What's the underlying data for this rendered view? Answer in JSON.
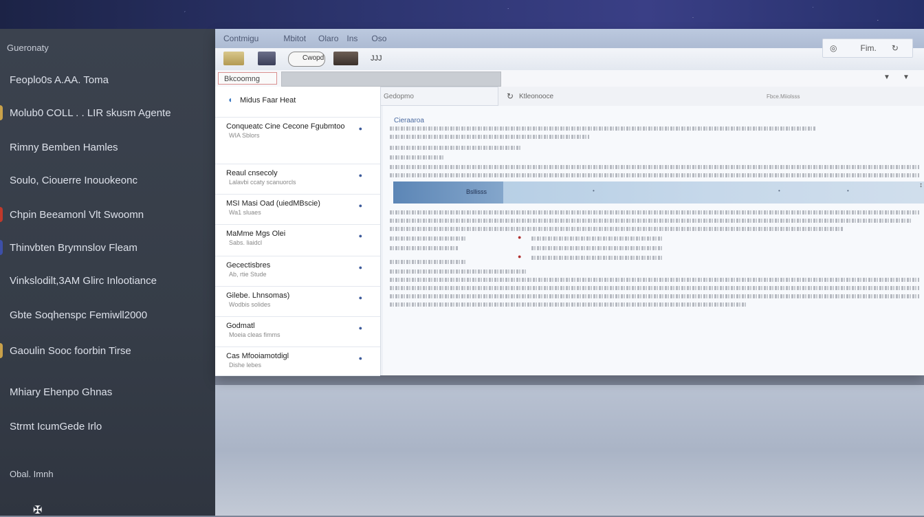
{
  "sidebar": {
    "header": "Gueronaty",
    "items": [
      {
        "label": "Feoplo0s A.AA. Toma",
        "color": ""
      },
      {
        "label": "Molub0 COLL . . LIR skusm Agente",
        "color": "#c9a14a"
      },
      {
        "label": "Rimny Bemben Hamles",
        "color": ""
      },
      {
        "label": "Soulo, Ciouerre Inouokeonc",
        "color": ""
      },
      {
        "label": "Chpin Beeamonl Vlt Swoomn",
        "color": "#c0392b"
      },
      {
        "label": "Thinvbten Brymnslov Fleam",
        "color": "#3d4fa8"
      },
      {
        "label": "Vinkslodilt,3AM Glirc Inlootiance",
        "color": ""
      },
      {
        "label": "Gbte Soqhenspc Femiwll2000",
        "color": ""
      },
      {
        "label": "Gaoulin Sooc foorbin Tirse",
        "color": "#c9a14a"
      },
      {
        "label": "Mhiary Ehenpo Ghnas",
        "color": ""
      },
      {
        "label": "Strmt IcumGede Irlo",
        "color": ""
      }
    ],
    "footer": "Obal. Imnh",
    "bottom_icon": "app-icon"
  },
  "menu": [
    "Contmigu",
    "Mbitot",
    "Olaro",
    "Ins",
    "Oso"
  ],
  "toolbar": {
    "compose_label": "Cwopd",
    "extra_label": "JJJ"
  },
  "window_controls": {
    "label": "Fim.",
    "icons": [
      "settings-icon",
      "refresh-icon"
    ]
  },
  "address": {
    "label": "Bkcoomng"
  },
  "messages": [
    {
      "title": "Midus Faar Heat",
      "sub": ""
    },
    {
      "title": "Conqueatc Cine Cecone Fgubmtoo",
      "sub": "WIA  Sblors"
    },
    {
      "title": "Reaul cnsecoly",
      "sub": "Lalavbi  ccaty  scanuorcls"
    },
    {
      "title": "MSI Masi Oad (uiedMBscie)",
      "sub": "Wa1 sluaes"
    },
    {
      "title": "MaMme Mgs Olei",
      "sub": "Sabs. liaidcl"
    },
    {
      "title": "Gecectisbres",
      "sub": "Ab, rtie Stude"
    },
    {
      "title": "Gilebe. Lhnsomas)",
      "sub": "Wodbis solides"
    },
    {
      "title": "Godmatl",
      "sub": "Moeia  cleas fimms"
    },
    {
      "title": "Cas Mfooiamotdigl",
      "sub": "Dishe  lebes"
    }
  ],
  "search": {
    "placeholder": "Gedopmo"
  },
  "pane": {
    "header_title": "Ktleonooce",
    "header_meta": "Fbce.Miiolsss",
    "heading": "Cieraaroa",
    "band_label": "Bsllisss"
  }
}
